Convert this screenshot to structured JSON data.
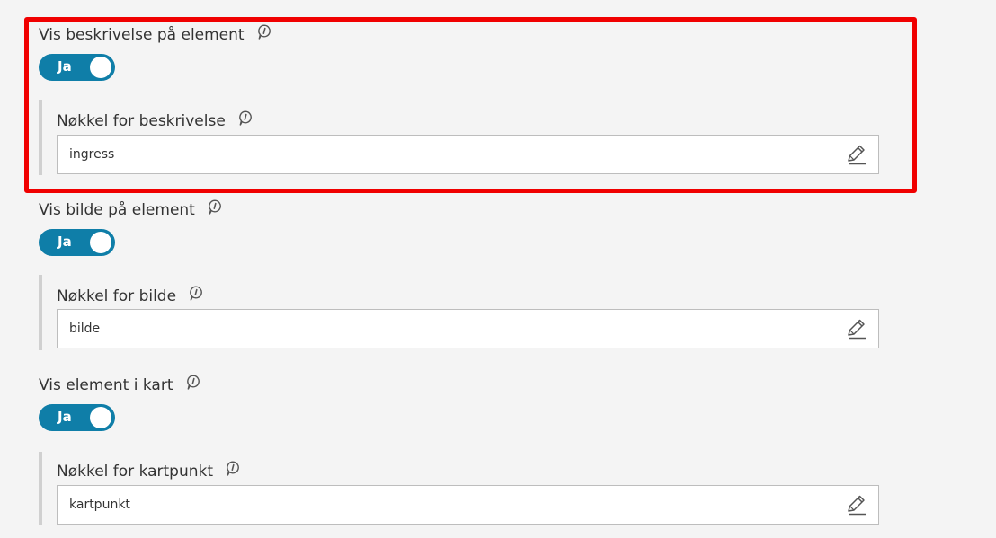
{
  "sections": [
    {
      "toggle_label": "Vis beskrivelse på element",
      "toggle_value": "Ja",
      "field_label": "Nøkkel for beskrivelse",
      "field_value": "ingress"
    },
    {
      "toggle_label": "Vis bilde på element",
      "toggle_value": "Ja",
      "field_label": "Nøkkel for bilde",
      "field_value": "bilde"
    },
    {
      "toggle_label": "Vis element i kart",
      "toggle_value": "Ja",
      "field_label": "Nøkkel for kartpunkt",
      "field_value": "kartpunkt"
    }
  ],
  "colors": {
    "toggle_on": "#0f7ea8",
    "highlight": "#f00000",
    "background": "#f4f4f4"
  },
  "icons": {
    "info": "info-icon",
    "edit": "pencil-icon"
  }
}
